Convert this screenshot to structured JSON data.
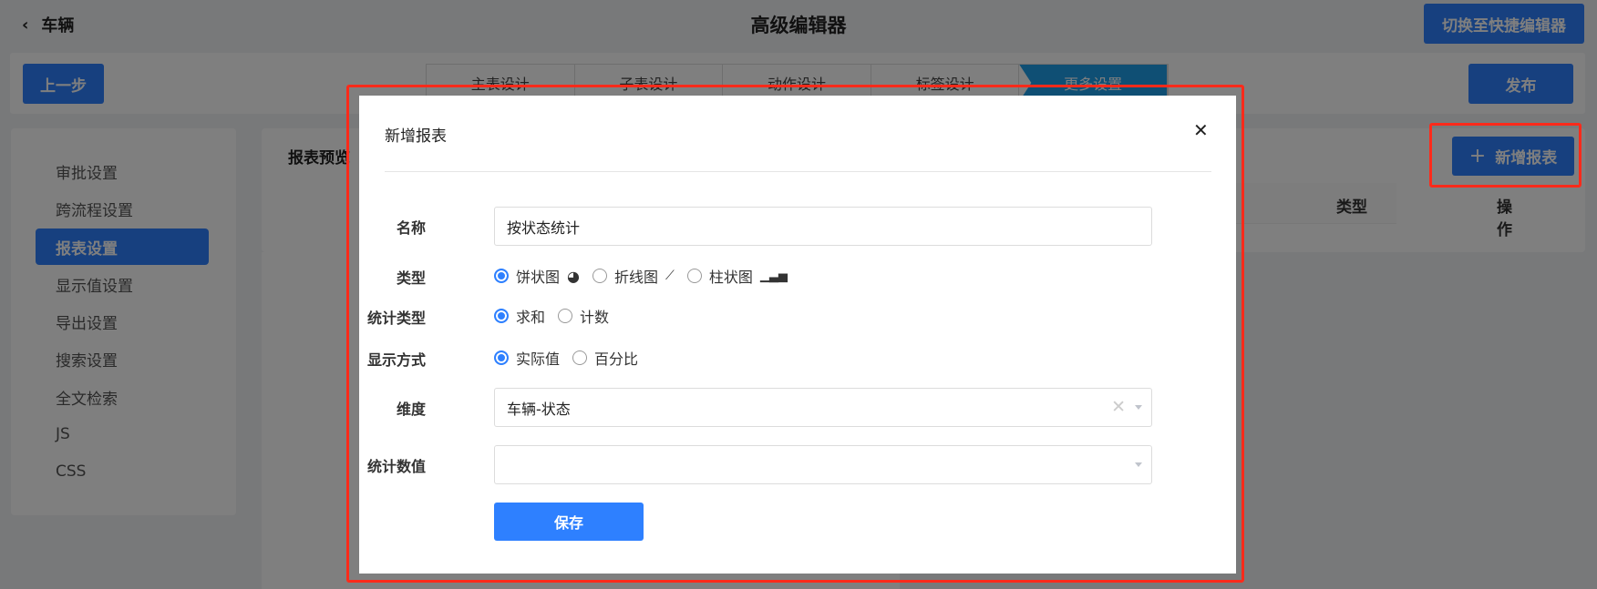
{
  "header": {
    "back_label": "车辆",
    "title": "高级编辑器",
    "switch_button": "切换至快捷编辑器"
  },
  "toolbar": {
    "prev_button": "上一步",
    "publish_button": "发布",
    "steps": [
      "主表设计",
      "子表设计",
      "动作设计",
      "标签设计",
      "更多设置"
    ],
    "active_step": 4
  },
  "sidebar": {
    "items": [
      "审批设置",
      "跨流程设置",
      "报表设置",
      "显示值设置",
      "导出设置",
      "搜索设置",
      "全文检索",
      "JS",
      "CSS"
    ],
    "active_index": 2
  },
  "main": {
    "section_title": "报表预览",
    "add_button": "新增报表",
    "columns": [
      "类型",
      "操作"
    ]
  },
  "modal": {
    "title": "新增报表",
    "fields": {
      "name": {
        "label": "名称",
        "value": "按状态统计"
      },
      "type": {
        "label": "类型",
        "options": [
          "饼状图",
          "折线图",
          "柱状图"
        ],
        "selected": 0
      },
      "stat_type": {
        "label": "统计类型",
        "options": [
          "求和",
          "计数"
        ],
        "selected": 0
      },
      "display": {
        "label": "显示方式",
        "options": [
          "实际值",
          "百分比"
        ],
        "selected": 0
      },
      "dimension": {
        "label": "维度",
        "value": "车辆-状态"
      },
      "stat_value": {
        "label": "统计数值",
        "value": ""
      }
    },
    "save_button": "保存"
  },
  "colors": {
    "primary": "#2e80ff",
    "highlight": "#ff2a1a"
  }
}
